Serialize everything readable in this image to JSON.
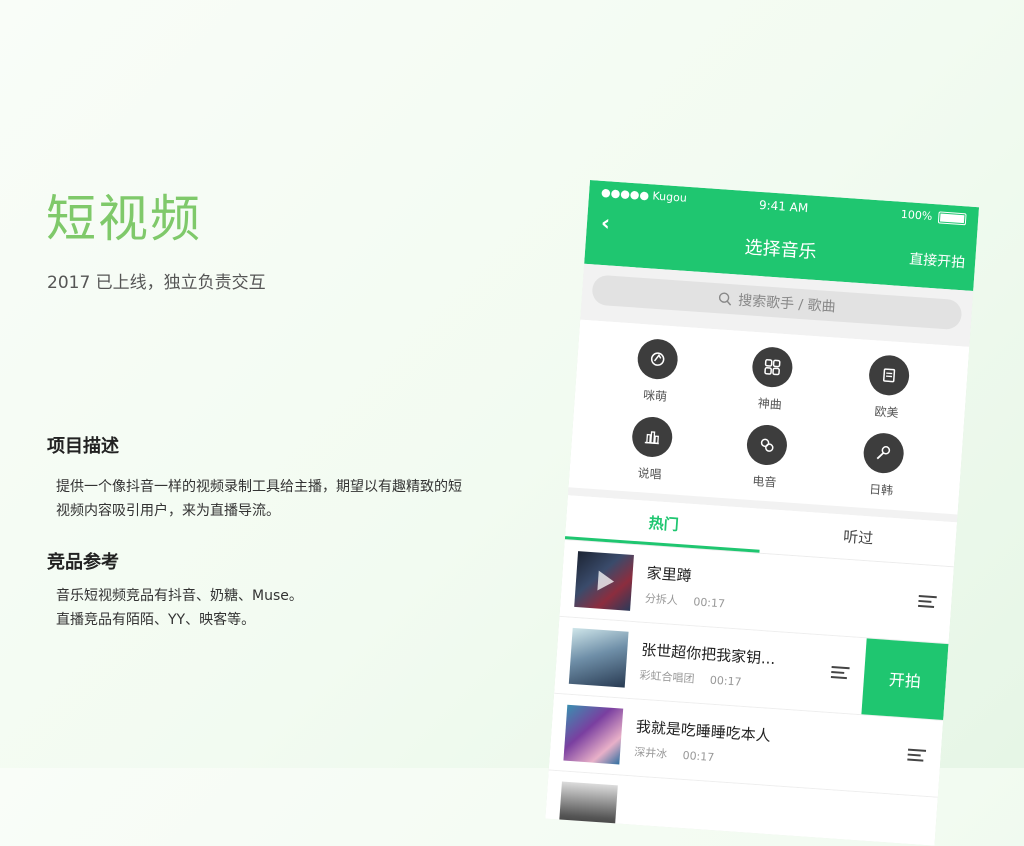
{
  "intro": {
    "title": "短视频",
    "subtitle": "2017 已上线，独立负责交互"
  },
  "sections": [
    {
      "heading": "项目描述",
      "lines": [
        "提供一个像抖音一样的视频录制工具给主播，期望以有趣精致的短",
        "视频内容吸引用户，来为直播导流。"
      ]
    },
    {
      "heading": "竞品参考",
      "lines": [
        "音乐短视频竞品有抖音、奶糖、Muse。",
        "直播竞品有陌陌、YY、映客等。"
      ]
    }
  ],
  "phone": {
    "status": {
      "carrier": "●●●●● Kugou",
      "time": "9:41 AM",
      "battery": "100%"
    },
    "nav": {
      "back": "‹",
      "title": "选择音乐",
      "right_action": "直接开拍"
    },
    "search": {
      "placeholder": "搜索歌手 / 歌曲"
    },
    "categories": [
      {
        "label": "咪萌",
        "icon": "mimeng-icon"
      },
      {
        "label": "神曲",
        "icon": "shenqu-icon"
      },
      {
        "label": "欧美",
        "icon": "oumei-icon"
      },
      {
        "label": "说唱",
        "icon": "shuochang-icon"
      },
      {
        "label": "电音",
        "icon": "dianyin-icon"
      },
      {
        "label": "日韩",
        "icon": "rihan-icon"
      }
    ],
    "tabs": [
      {
        "label": "热门"
      },
      {
        "label": "听过"
      }
    ],
    "songs": [
      {
        "title": "家里蹲",
        "artist": "分拆人",
        "duration": "00:17"
      },
      {
        "title": "张世超你把我家钥...",
        "artist": "彩虹合唱团",
        "duration": "00:17",
        "action": "开拍"
      },
      {
        "title": "我就是吃睡睡吃本人",
        "artist": "深井冰",
        "duration": "00:17"
      }
    ],
    "colors": {
      "accent": "#1fc670",
      "title_green": "#7fc96a"
    }
  }
}
